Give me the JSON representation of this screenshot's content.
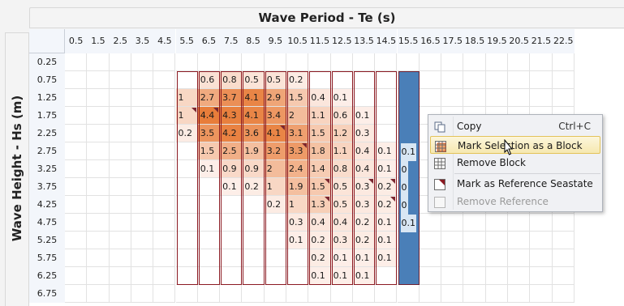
{
  "title_top": "Wave Period - Te (s)",
  "title_side": "Wave Height - Hs (m)",
  "columns": [
    "0.5",
    "1.5",
    "2.5",
    "3.5",
    "4.5",
    "5.5",
    "6.5",
    "7.5",
    "8.5",
    "9.5",
    "10.5",
    "11.5",
    "12.5",
    "13.5",
    "14.5",
    "15.5",
    "16.5",
    "17.5",
    "18.5",
    "19.5",
    "20.5",
    "21.5",
    "22.5"
  ],
  "rows": [
    "0.25",
    "0.75",
    "1.25",
    "1.75",
    "2.25",
    "2.75",
    "3.25",
    "3.75",
    "4.25",
    "4.75",
    "5.25",
    "5.75",
    "6.25",
    "6.75"
  ],
  "cells": [
    [
      "",
      "",
      "",
      "",
      "",
      "",
      "",
      "",
      "",
      "",
      "",
      "",
      "",
      "",
      "",
      "",
      "",
      "",
      "",
      "",
      "",
      "",
      ""
    ],
    [
      "",
      "",
      "",
      "",
      "",
      "",
      "0.6",
      "0.8",
      "0.5",
      "0.5",
      "0.2",
      "",
      "",
      "",
      "",
      "",
      "",
      "",
      "",
      "",
      "",
      "",
      ""
    ],
    [
      "",
      "",
      "",
      "",
      "",
      "1",
      "2.7",
      "3.7",
      "4.1",
      "2.9",
      "1.5",
      "0.4",
      "0.1",
      "",
      "",
      "",
      "",
      "",
      "",
      "",
      "",
      "",
      ""
    ],
    [
      "",
      "",
      "",
      "",
      "",
      "1",
      "4.4",
      "4.3",
      "4.1",
      "3.4",
      "2",
      "1.1",
      "0.6",
      "0.1",
      "",
      "",
      "",
      "",
      "",
      "",
      "",
      "",
      ""
    ],
    [
      "",
      "",
      "",
      "",
      "",
      "0.2",
      "3.5",
      "4.2",
      "3.6",
      "4.1",
      "3.1",
      "1.5",
      "1.2",
      "0.3",
      "",
      "",
      "",
      "",
      "",
      "",
      "",
      "",
      ""
    ],
    [
      "",
      "",
      "",
      "",
      "",
      "",
      "1.5",
      "2.5",
      "1.9",
      "3.2",
      "3.3",
      "1.8",
      "1.1",
      "0.4",
      "0.1",
      "0.1",
      "",
      "",
      "",
      "",
      "",
      "",
      ""
    ],
    [
      "",
      "",
      "",
      "",
      "",
      "",
      "0.1",
      "0.9",
      "0.9",
      "2",
      "2.4",
      "1.4",
      "0.8",
      "0.4",
      "0.1",
      "0",
      "",
      "",
      "",
      "",
      "",
      "",
      ""
    ],
    [
      "",
      "",
      "",
      "",
      "",
      "",
      "",
      "0.1",
      "0.2",
      "1",
      "1.9",
      "1.5",
      "0.5",
      "0.3",
      "0.2",
      "0",
      "",
      "",
      "",
      "",
      "",
      "",
      ""
    ],
    [
      "",
      "",
      "",
      "",
      "",
      "",
      "",
      "",
      "",
      "0.2",
      "1",
      "1.3",
      "0.5",
      "0.3",
      "0.2",
      "0",
      "",
      "",
      "",
      "",
      "",
      "",
      ""
    ],
    [
      "",
      "",
      "",
      "",
      "",
      "",
      "",
      "",
      "",
      "",
      "0.3",
      "0.4",
      "0.4",
      "0.2",
      "0.1",
      "0.1",
      "",
      "",
      "",
      "",
      "",
      "",
      ""
    ],
    [
      "",
      "",
      "",
      "",
      "",
      "",
      "",
      "",
      "",
      "",
      "0.1",
      "0.2",
      "0.3",
      "0.2",
      "0.1",
      "",
      "",
      "",
      "",
      "",
      "",
      "",
      ""
    ],
    [
      "",
      "",
      "",
      "",
      "",
      "",
      "",
      "",
      "",
      "",
      "",
      "0.2",
      "0.1",
      "0.1",
      "0.1",
      "",
      "",
      "",
      "",
      "",
      "",
      "",
      ""
    ],
    [
      "",
      "",
      "",
      "",
      "",
      "",
      "",
      "",
      "",
      "",
      "",
      "0.1",
      "0.1",
      "0.1",
      "",
      "",
      "",
      "",
      "",
      "",
      "",
      "",
      ""
    ],
    [
      "",
      "",
      "",
      "",
      "",
      "",
      "",
      "",
      "",
      "",
      "",
      "",
      "",
      "",
      "",
      "",
      "",
      "",
      "",
      "",
      "",
      "",
      ""
    ]
  ],
  "reference_cells": [
    [
      3,
      5
    ],
    [
      3,
      6
    ],
    [
      4,
      9
    ],
    [
      5,
      10
    ],
    [
      7,
      11
    ],
    [
      7,
      13
    ],
    [
      7,
      14
    ],
    [
      8,
      11
    ],
    [
      8,
      14
    ]
  ],
  "selected_column": "15.5",
  "colors": {
    "block_border": "#8b1a22",
    "selection": "#4a7fb8",
    "menu_highlight": "#f6e8b0",
    "heat_low": "#fdf1ec",
    "heat_high": "#e87d3a"
  },
  "context_menu": {
    "items": [
      {
        "label": "Copy",
        "shortcut": "Ctrl+C",
        "icon": "copy-icon",
        "enabled": true,
        "highlighted": false
      },
      {
        "label": "Mark Selection as a Block",
        "shortcut": "",
        "icon": "mark-block-icon",
        "enabled": true,
        "highlighted": true
      },
      {
        "label": "Remove Block",
        "shortcut": "",
        "icon": "remove-block-icon",
        "enabled": true,
        "highlighted": false
      },
      {
        "label": "Mark as Reference Seastate",
        "shortcut": "",
        "icon": "reference-seastate-icon",
        "enabled": true,
        "highlighted": false
      },
      {
        "label": "Remove Reference",
        "shortcut": "",
        "icon": "remove-reference-icon",
        "enabled": false,
        "highlighted": false
      }
    ]
  }
}
